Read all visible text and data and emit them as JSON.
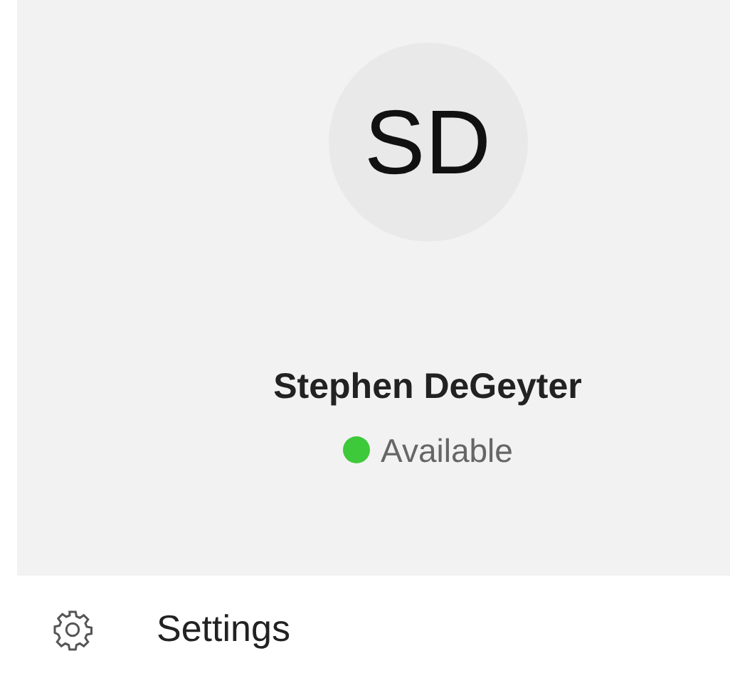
{
  "profile": {
    "initials": "SD",
    "name": "Stephen DeGeyter",
    "status": {
      "label": "Available",
      "color": "#3ec93a"
    }
  },
  "menu": [
    {
      "label": "Settings"
    }
  ]
}
